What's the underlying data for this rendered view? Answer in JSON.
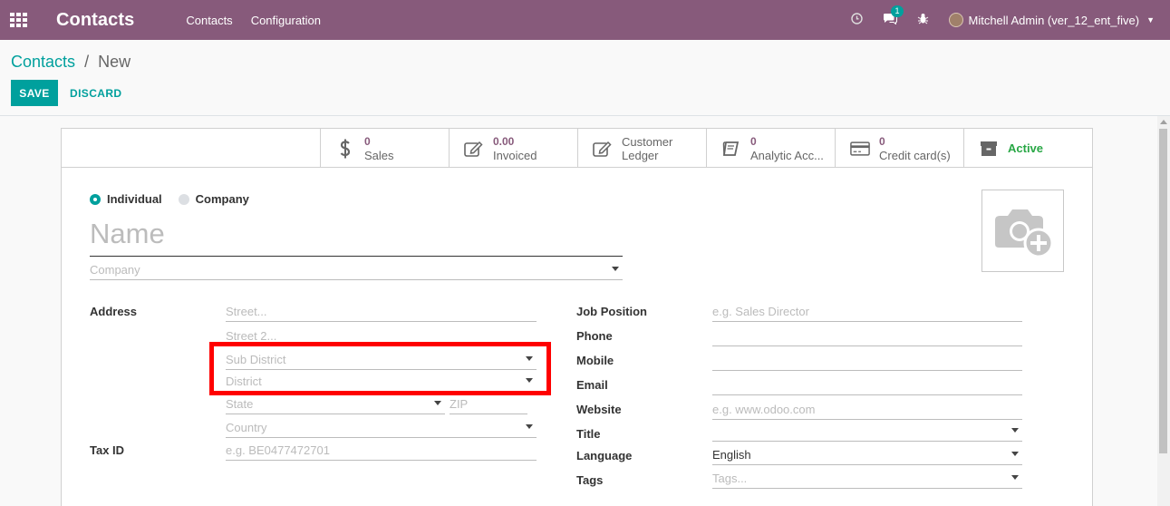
{
  "navbar": {
    "brand": "Contacts",
    "menu": [
      "Contacts",
      "Configuration"
    ],
    "message_count": "1",
    "user": "Mitchell Admin (ver_12_ent_five)"
  },
  "breadcrumb": {
    "parent": "Contacts",
    "separator": "/",
    "current": "New"
  },
  "actions": {
    "save": "SAVE",
    "discard": "DISCARD"
  },
  "smart_buttons": [
    {
      "value": "0",
      "label": "Sales",
      "icon": "dollar-icon"
    },
    {
      "value": "0.00",
      "label": "Invoiced",
      "icon": "pencil-square-icon"
    },
    {
      "value": "Customer",
      "label": "Ledger",
      "icon": "pencil-square-icon"
    },
    {
      "value": "0",
      "label": "Analytic Acc...",
      "icon": "book-icon"
    },
    {
      "value": "0",
      "label": "Credit card(s)",
      "icon": "credit-card-icon"
    },
    {
      "value": "",
      "label": "Active",
      "icon": "archive-icon"
    }
  ],
  "form": {
    "company_type": {
      "individual": "Individual",
      "company": "Company"
    },
    "name_placeholder": "Name",
    "company_placeholder": "Company",
    "address_label": "Address",
    "street_placeholder": "Street...",
    "street2_placeholder": "Street 2...",
    "sub_district_placeholder": "Sub District",
    "district_placeholder": "District",
    "state_placeholder": "State",
    "zip_placeholder": "ZIP",
    "country_placeholder": "Country",
    "tax_id_label": "Tax ID",
    "tax_id_placeholder": "e.g. BE0477472701",
    "job_position_label": "Job Position",
    "job_position_placeholder": "e.g. Sales Director",
    "phone_label": "Phone",
    "mobile_label": "Mobile",
    "email_label": "Email",
    "website_label": "Website",
    "website_placeholder": "e.g. www.odoo.com",
    "title_label": "Title",
    "language_label": "Language",
    "language_value": "English",
    "tags_label": "Tags",
    "tags_placeholder": "Tags..."
  },
  "colors": {
    "navbar": "#875a7b",
    "primary": "#00a09d",
    "highlight": "#ff0000",
    "active": "#28a745"
  }
}
